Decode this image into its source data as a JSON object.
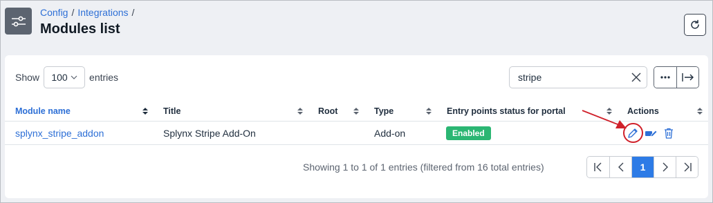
{
  "breadcrumb": [
    "Config",
    "Integrations"
  ],
  "breadcrumb_sep": "/",
  "page_title": "Modules list",
  "show": {
    "prefix": "Show",
    "value": "100",
    "suffix": "entries"
  },
  "search": {
    "value": "stripe"
  },
  "table": {
    "headers": [
      "Module name",
      "Title",
      "Root",
      "Type",
      "Entry points status for portal",
      "Actions"
    ],
    "rows": [
      {
        "module_name": "splynx_stripe_addon",
        "title": "Splynx Stripe Add-On",
        "root": "",
        "type": "Add-on",
        "status": "Enabled"
      }
    ]
  },
  "footer": {
    "info": "Showing 1 to 1 of 1 entries (filtered from 16 total entries)",
    "current_page": "1"
  },
  "colors": {
    "accent": "#2d7be6",
    "link": "#2d6fd6",
    "enabled": "#2bb673",
    "highlight": "#d0202a"
  },
  "icons": [
    "sliders-icon",
    "refresh-icon",
    "chevron-down-icon",
    "clear-icon",
    "more-icon",
    "export-icon",
    "sort-icon",
    "edit-icon",
    "edit-pay-icon",
    "trash-icon",
    "first-page-icon",
    "prev-page-icon",
    "next-page-icon",
    "last-page-icon"
  ]
}
